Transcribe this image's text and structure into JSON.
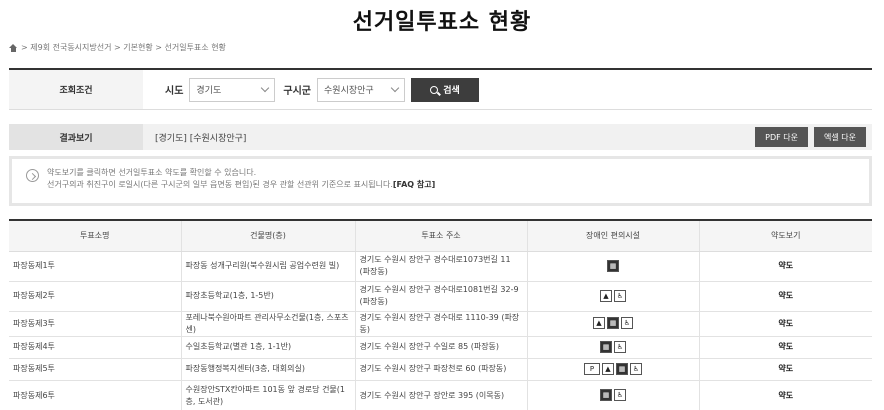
{
  "page": {
    "title": "선거일투표소 현황"
  },
  "breadcrumb": {
    "text": "> 제9회 전국동시지방선거 > 기본현황 > 선거일투표소 현황"
  },
  "search": {
    "label": "조회조건",
    "sido_label": "시도",
    "sido_value": "경기도",
    "gu_label": "구시군",
    "gu_value": "수원시장안구",
    "button": "검색"
  },
  "result": {
    "label": "결과보기",
    "value": "[경기도] [수원시장안구]",
    "pdf_button": "PDF 다운",
    "excel_button": "엑셀 다운"
  },
  "notice": {
    "line1": "약도보기를 클릭하면 선거일투표소 약도를 확인할 수 있습니다.",
    "line2": "선거구의과 취진구이 로일시(다른 구시군의 일부 읍면동 편입)된 경우 관할 선관위 기준으로 표시됩니다.",
    "faq": "[FAQ 참고]"
  },
  "table": {
    "headers": [
      "투표소명",
      "건물명(층)",
      "투표소 주소",
      "장애인 편의시설",
      "약도보기"
    ],
    "rows": [
      {
        "name": "파장동제1투",
        "building": "파장동 성개구리원(북수원시립 공업수련원 빌)",
        "address": "경기도 수원시 장안구 경수대로1073번길 11 (파장동)",
        "facilities": [
          "elevator-icon"
        ],
        "map": "약도"
      },
      {
        "name": "파장동제2투",
        "building": "파장초등학교(1층, 1-5반)",
        "address": "경기도 수원시 장안구 경수대로1081번길 32-9 (파장동)",
        "facilities": [
          "ramp-icon",
          "wheelchair-icon"
        ],
        "map": "약도"
      },
      {
        "name": "파장동제3투",
        "building": "포레나북수원아파트 관리사무소건물(1층, 스포츠센)",
        "address": "경기도 수원시 장안구 경수대로 1110-39 (파장동)",
        "facilities": [
          "ramp-icon",
          "elevator-icon",
          "wheelchair-icon"
        ],
        "map": "약도"
      },
      {
        "name": "파장동제4투",
        "building": "수일초등학교(별관 1층, 1-1반)",
        "address": "경기도 수원시 장안구 수일로 85 (파장동)",
        "facilities": [
          "elevator-icon",
          "wheelchair-icon"
        ],
        "map": "약도"
      },
      {
        "name": "파장동제5투",
        "building": "파장동행정복지센터(3층, 대회의실)",
        "address": "경기도 수원시 장안구 파장천로 60 (파장동)",
        "facilities": [
          "parking-icon",
          "ramp-icon",
          "elevator-icon",
          "wheelchair-icon"
        ],
        "map": "약도"
      },
      {
        "name": "파장동제6투",
        "building": "수원장안STX칸아파트 101동 앞 경로당 건물(1층, 도서관)",
        "address": "경기도 수원시 장안구 장안로 395 (이목동)",
        "facilities": [
          "elevator-icon",
          "wheelchair-icon"
        ],
        "map": "약도"
      }
    ]
  },
  "icons": {
    "elevator-icon": "▦",
    "ramp-icon": "▲",
    "wheelchair-icon": "♿",
    "parking-icon": "P"
  }
}
